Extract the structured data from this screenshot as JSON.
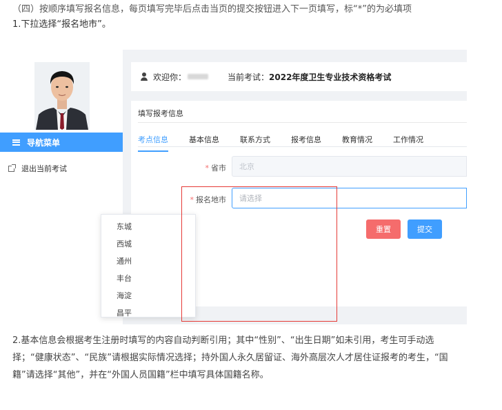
{
  "intro": {
    "heading": "（四）按顺序填写报名信息，每页填写完毕后点击当页的提交按钮进入下一页填写，标“*”的为必填项",
    "step1": "1.下拉选择“报名地市”。"
  },
  "sidebar": {
    "nav_label": "导航菜单",
    "exit_label": "退出当前考试"
  },
  "welcome": {
    "greeting": "欢迎你：",
    "exam_label": "当前考试：",
    "exam_name": "2022年度卫生专业技术资格考试"
  },
  "form": {
    "title": "填写报考信息",
    "tabs": [
      "考点信息",
      "基本信息",
      "联系方式",
      "报考信息",
      "教育情况",
      "工作情况"
    ],
    "province_label": "省市",
    "province_value": "北京",
    "city_label": "报名地市",
    "city_placeholder": "请选择",
    "required_mark": "*",
    "reset_label": "重置",
    "submit_label": "提交",
    "options": [
      "东城",
      "西城",
      "通州",
      "丰台",
      "海淀",
      "昌平"
    ]
  },
  "outro": {
    "text": "2.基本信息会根据考生注册时填写的内容自动判断引用；其中“性别”、“出生日期”如未引用，考生可手动选择；“健康状态”、“民族”请根据实际情况选择；持外国人永久居留证、海外高层次人才居住证报考的考生，“国籍”请选择“其他”，并在“外国人员国籍”栏中填写具体国籍名称。"
  },
  "colors": {
    "primary": "#409eff",
    "danger": "#f56c6c",
    "highlight_box": "#e53935"
  }
}
